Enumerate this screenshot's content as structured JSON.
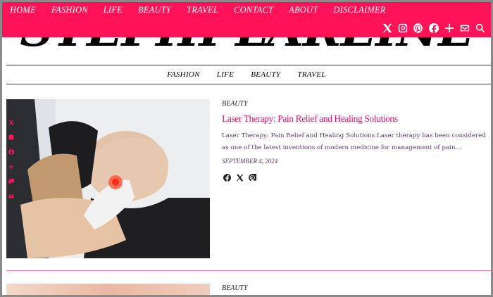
{
  "site": {
    "logo_text": "STEPHI LAREINE",
    "accent_color": "#ff1358"
  },
  "top_nav": [
    {
      "label": "HOME"
    },
    {
      "label": "FASHION"
    },
    {
      "label": "LIFE"
    },
    {
      "label": "BEAUTY"
    },
    {
      "label": "TRAVEL"
    },
    {
      "label": "CONTACT"
    },
    {
      "label": "ABOUT"
    },
    {
      "label": "DISCLAIMER"
    }
  ],
  "social_icons": [
    "x-icon",
    "instagram-icon",
    "pinterest-icon",
    "facebook-icon",
    "plus-icon",
    "email-icon",
    "search-icon"
  ],
  "sub_nav": [
    {
      "label": "FASHION"
    },
    {
      "label": "LIFE"
    },
    {
      "label": "BEAUTY"
    },
    {
      "label": "TRAVEL"
    }
  ],
  "floating_share": [
    "x-icon",
    "instagram-icon",
    "facebook-icon",
    "plus-icon",
    "pinterest-icon",
    "email-icon"
  ],
  "articles": [
    {
      "category": "BEAUTY",
      "title": "Laser Therapy: Pain Relief and Healing Solutions",
      "excerpt": "Laser Therapy: Pain Relief and Healing Solutions Laser therapy has been considered as one of the latest inventions of modern medicine for management of pain…",
      "date": "SEPTEMBER 4, 2024",
      "share_icons": [
        "facebook-icon",
        "x-icon",
        "pinterest-icon"
      ]
    },
    {
      "category": "BEAUTY"
    }
  ]
}
